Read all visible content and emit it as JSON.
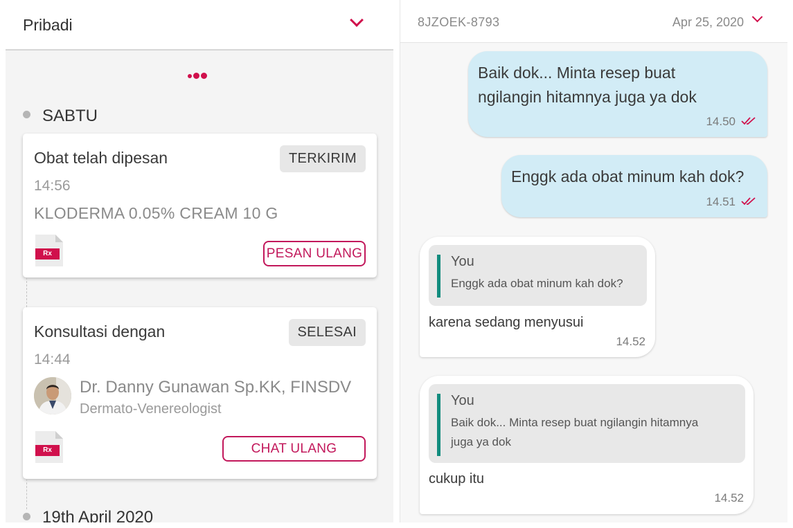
{
  "left": {
    "header_title": "Pribadi",
    "sections": [
      {
        "label": "SABTU"
      },
      {
        "label": "19th April 2020"
      }
    ],
    "order_card": {
      "title": "Obat telah dipesan",
      "status": "TERKIRIM",
      "time": "14:56",
      "drug": "KLODERMA 0.05% CREAM 10 G",
      "rx_label": "Rx",
      "action_label": "PESAN ULANG"
    },
    "consult_card": {
      "title": "Konsultasi dengan",
      "status": "SELESAI",
      "time": "14:44",
      "doctor_name": "Dr. Danny Gunawan Sp.KK, FINSDV",
      "doctor_specialty": "Dermato-Venereologist",
      "rx_label": "Rx",
      "action_label": "CHAT ULANG"
    }
  },
  "right": {
    "session_code": "8JZOEK-8793",
    "session_date": "Apr 25, 2020",
    "messages": [
      {
        "from": "me",
        "lines": [
          "Baik dok...  Minta resep buat",
          "ngilangin hitamnya juga ya dok"
        ],
        "time": "14.50",
        "status": "read"
      },
      {
        "from": "me",
        "lines": [
          "Enggk ada obat minum kah dok?"
        ],
        "time": "14.51",
        "status": "read"
      },
      {
        "from": "doctor",
        "quote_author": "You",
        "quote_lines": [
          "Enggk ada obat minum kah dok?"
        ],
        "text": "karena sedang menyusui",
        "time": "14.52"
      },
      {
        "from": "doctor",
        "quote_author": "You",
        "quote_lines": [
          "Baik dok...  Minta resep buat ngilangin hitamnya",
          "juga ya dok"
        ],
        "text": "cukup itu",
        "time": "14.52"
      }
    ]
  },
  "colors": {
    "accent": "#d0104c",
    "outgoing_bubble": "#d2ecf6",
    "quote_bar": "#128c7e",
    "panel_bg": "#f4f4f4"
  },
  "icons": {
    "header_toggle": "chevron-down-icon",
    "loading": "dots-icon",
    "prescription": "rx-document-icon",
    "read_receipt": "double-check-icon"
  }
}
